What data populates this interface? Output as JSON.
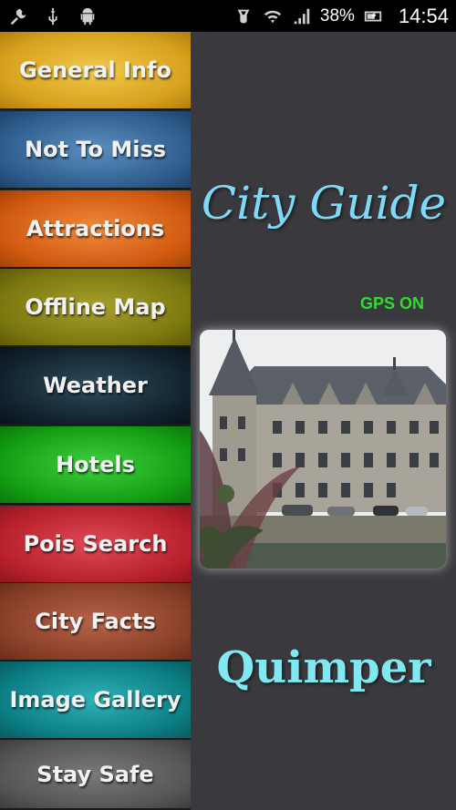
{
  "status_bar": {
    "left_icons": [
      "tools-icon",
      "usb-icon",
      "android-icon"
    ],
    "right_icons": [
      "sim-icon",
      "wifi-icon",
      "signal-icon",
      "battery-icon"
    ],
    "battery": "38%",
    "time": "14:54"
  },
  "menu": {
    "items": [
      {
        "label": "General Info",
        "color": "#d7a11d"
      },
      {
        "label": "Not To Miss",
        "color": "#2f5e8e"
      },
      {
        "label": "Attractions",
        "color": "#d15a10"
      },
      {
        "label": "Offline Map",
        "color": "#7c7810"
      },
      {
        "label": "Weather",
        "color": "#12232e"
      },
      {
        "label": "Hotels",
        "color": "#139e13"
      },
      {
        "label": "Pois Search",
        "color": "#b9212c"
      },
      {
        "label": "City Facts",
        "color": "#8a4028"
      },
      {
        "label": "Image Gallery",
        "color": "#0b7e84"
      },
      {
        "label": "Stay Safe",
        "color": "#565656"
      }
    ]
  },
  "main": {
    "title": "City Guide",
    "gps_status": "GPS ON",
    "city_name": "Quimper",
    "title_color": "#7fd8f5",
    "gps_color": "#2fdc2f"
  }
}
